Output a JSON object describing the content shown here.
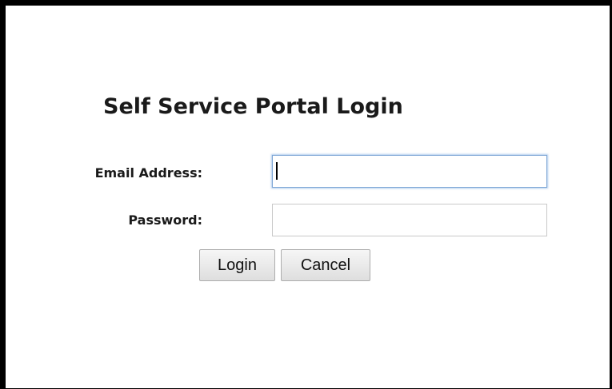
{
  "login": {
    "title": "Self Service Portal Login",
    "email_label": "Email Address:",
    "email_value": "",
    "password_label": "Password:",
    "password_value": "",
    "login_label": "Login",
    "cancel_label": "Cancel"
  },
  "colors": {
    "window_border": "#000000",
    "background": "#ffffff",
    "focus_border": "#7fa7d6",
    "input_border": "#c9c9c9",
    "text": "#1a1a1a"
  }
}
